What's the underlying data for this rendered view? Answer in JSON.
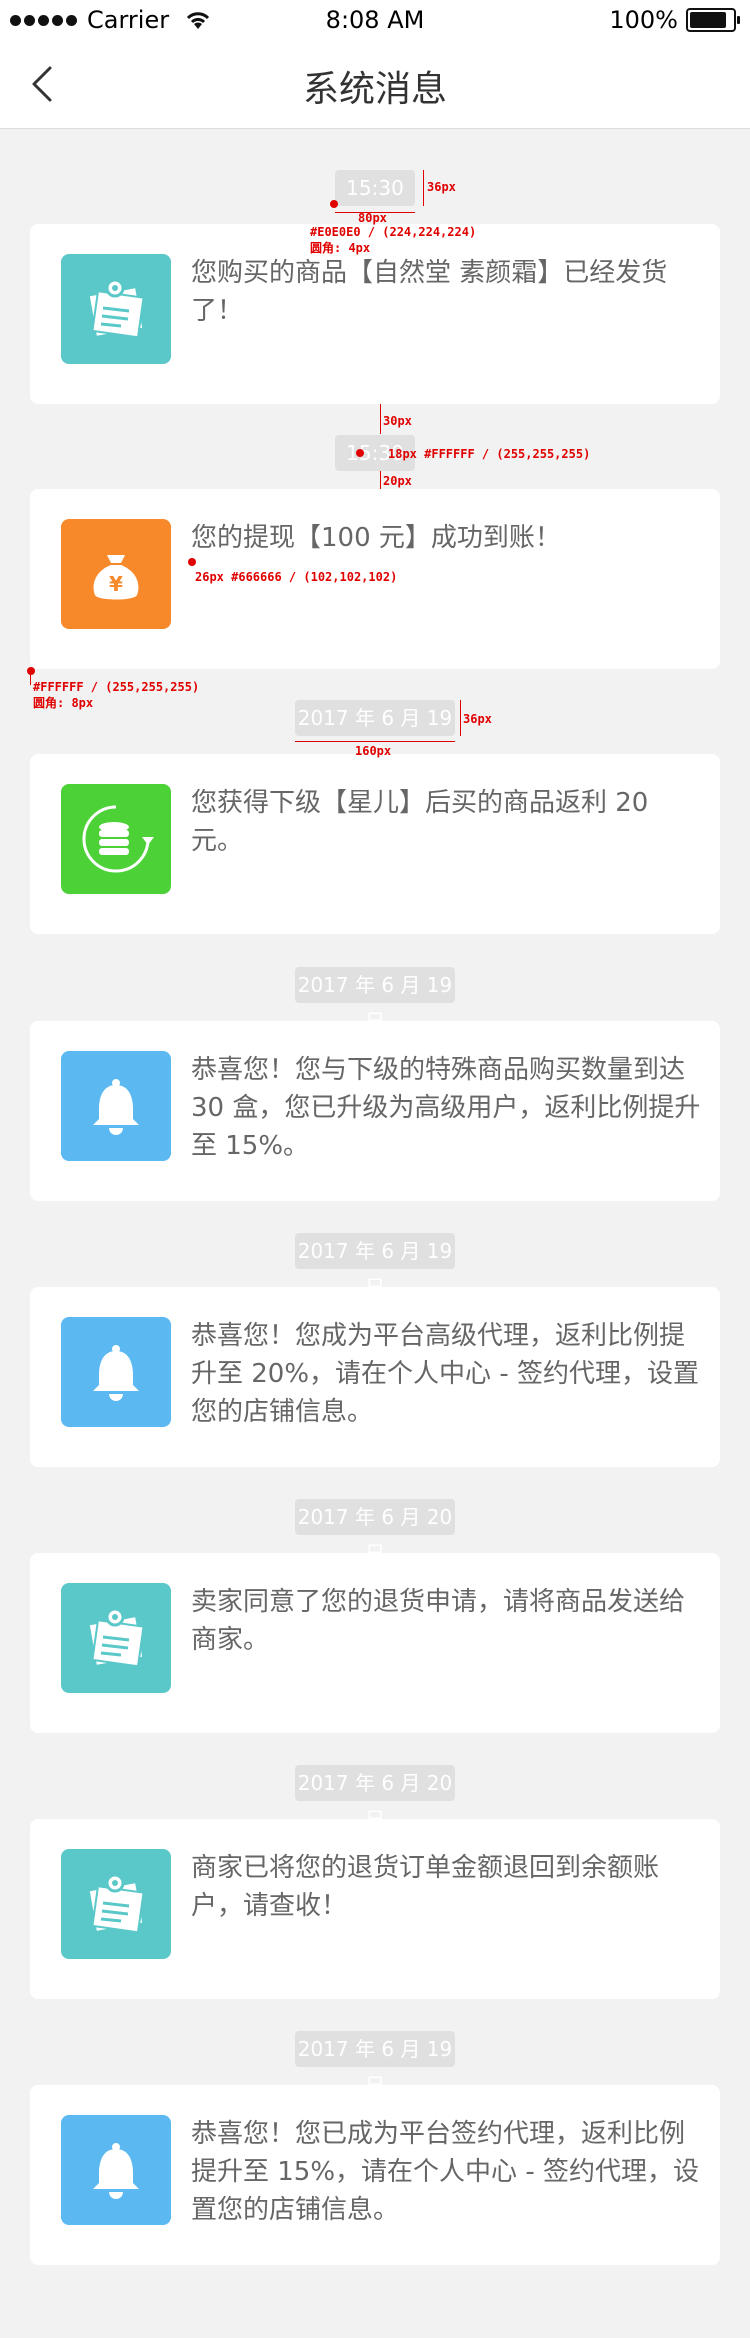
{
  "status_bar": {
    "carrier": "Carrier",
    "time": "8:08 AM",
    "battery": "100%"
  },
  "nav": {
    "title": "系统消息",
    "back_icon": "chevron-left-icon"
  },
  "colors": {
    "teal": "#5ac8c8",
    "orange": "#f7892a",
    "green": "#4cd137",
    "blue": "#5bb8f0",
    "label_bg": "#e0e0e0",
    "text": "#666666"
  },
  "messages": [
    {
      "time": "15:30",
      "text": "您购买的商品【自然堂 素颜霜】已经发货了！",
      "icon": "note-pin-icon"
    },
    {
      "time": "15:30",
      "text": "您的提现【100 元】成功到账！",
      "icon": "money-bag-icon"
    },
    {
      "time": "2017 年 6 月 19 日",
      "text": "您获得下级【星儿】后买的商品返利 20 元。",
      "icon": "coins-refresh-icon"
    },
    {
      "time": "2017 年 6 月 19 日",
      "text": "恭喜您！您与下级的特殊商品购买数量到达 30 盒，您已升级为高级用户，返利比例提升至 15%。",
      "icon": "bell-icon"
    },
    {
      "time": "2017 年 6 月 19 日",
      "text": "恭喜您！您成为平台高级代理，返利比例提升至 20%，请在个人中心 - 签约代理，设置您的店铺信息。",
      "icon": "bell-icon"
    },
    {
      "time": "2017 年 6 月 20 日",
      "text": "卖家同意了您的退货申请，请将商品发送给商家。",
      "icon": "note-pin-icon"
    },
    {
      "time": "2017 年 6 月 20 日",
      "text": "商家已将您的退货订单金额退回到余额账户，请查收！",
      "icon": "note-pin-icon"
    },
    {
      "time": "2017 年 6 月 19 日",
      "text": "恭喜您！您已成为平台签约代理，返利比例提升至 15%，请在个人中心 - 签约代理，设置您的店铺信息。",
      "icon": "bell-icon"
    }
  ],
  "annotations": {
    "a1": "36px",
    "a2": "80px",
    "a3": "#E0E0E0 / (224,224,224)",
    "a4": "圆角: 4px",
    "a5": "30px",
    "a6": "18px #FFFFFF / (255,255,255)",
    "a7": "20px",
    "a8": "26px #666666 / (102,102,102)",
    "a9": "#FFFFFF / (255,255,255)",
    "a10": "圆角: 8px",
    "a11": "36px",
    "a12": "160px"
  }
}
